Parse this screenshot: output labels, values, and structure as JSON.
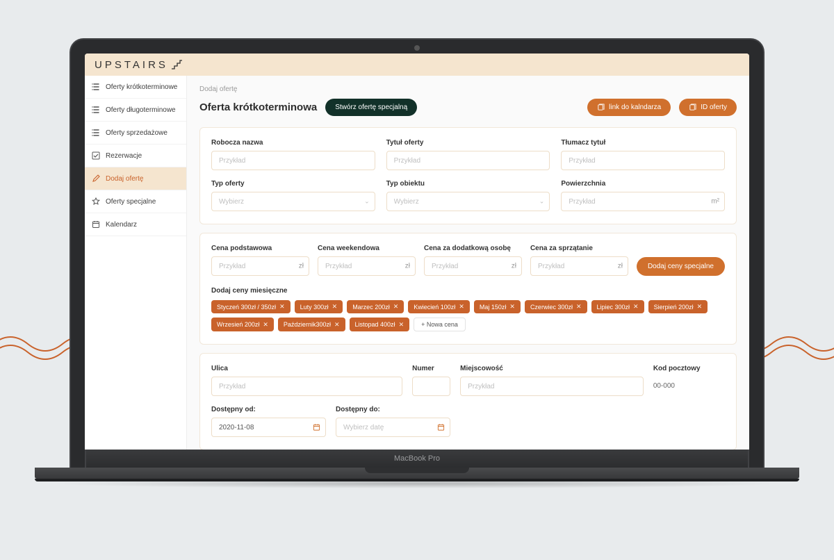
{
  "logo": "UPSTAIRS",
  "deck_text": "MacBook Pro",
  "sidebar": {
    "items": [
      {
        "label": "Oferty krótkoterminowe",
        "icon": "list"
      },
      {
        "label": "Oferty długoterminowe",
        "icon": "list"
      },
      {
        "label": "Oferty sprzedażowe",
        "icon": "list"
      },
      {
        "label": "Rezerwacje",
        "icon": "check"
      },
      {
        "label": "Dodaj ofertę",
        "icon": "edit"
      },
      {
        "label": "Oferty specjalne",
        "icon": "star"
      },
      {
        "label": "Kalendarz",
        "icon": "calendar"
      }
    ]
  },
  "breadcrumb": "Dodaj ofertę",
  "page_title": "Oferta krótkoterminowa",
  "btn_special": "Stwórz ofertę specjalną",
  "btn_link_calendar": "link do kalndarza",
  "btn_id_offer": "ID oferty",
  "section1": {
    "nazwa_label": "Robocza nazwa",
    "tytul_label": "Tytuł oferty",
    "tlumacz_label": "Tłumacz tytuł",
    "typ_oferty_label": "Typ oferty",
    "typ_obiektu_label": "Typ obiektu",
    "powierzchnia_label": "Powierzchnia",
    "placeholder": "Przykład",
    "select_placeholder": "Wybierz",
    "area_unit": "m²"
  },
  "section2": {
    "cena_podst_label": "Cena podstawowa",
    "cena_weekend_label": "Cena weekendowa",
    "cena_osoba_label": "Cena za dodatkową osobę",
    "cena_sprzat_label": "Cena za sprzątanie",
    "currency": "zł",
    "placeholder": "Przykład",
    "btn_add_special_prices": "Dodaj ceny specjalne",
    "monthly_label": "Dodaj ceny miesięczne",
    "tags": [
      "Styczeń 300zł / 350zł",
      "Luty 300zł",
      "Marzec 200zł",
      "Kwiecień 100zł",
      "Maj 150zł",
      "Czerwiec 300zł",
      "Lipiec 300zł",
      "Sierpień 200zł",
      "Wrzesień 200zł",
      "Październik300zł",
      "Listopad 400zł"
    ],
    "new_tag_label": "Nowa cena"
  },
  "section3": {
    "ulica_label": "Ulica",
    "numer_label": "Numer",
    "miejscowosc_label": "Miejscowość",
    "kod_label": "Kod pocztowy",
    "kod_value": "00-000",
    "placeholder": "Przykład",
    "dostepny_od_label": "Dostępny od:",
    "dostepny_do_label": "Dostępny do:",
    "date_from": "2020-11-08",
    "date_to_placeholder": "Wybierz datę"
  }
}
